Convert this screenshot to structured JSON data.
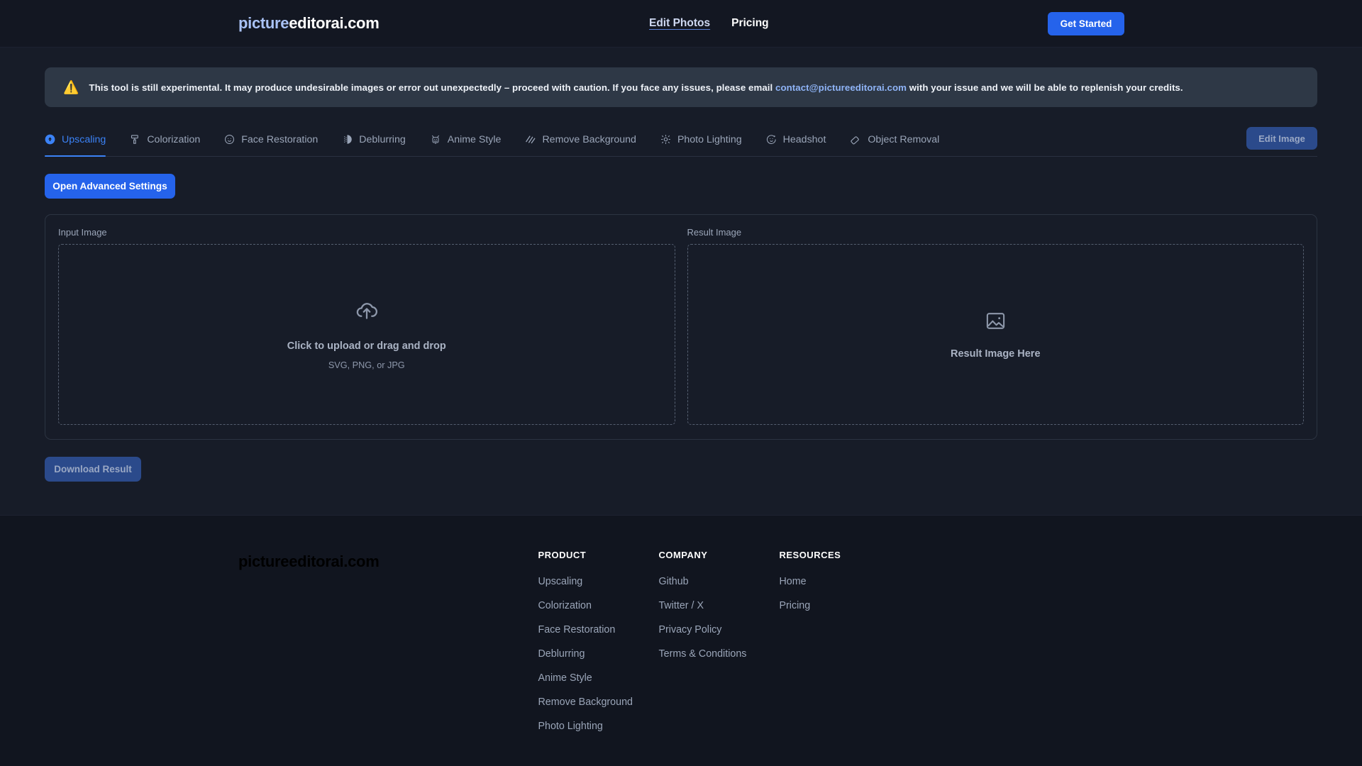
{
  "header": {
    "logo_part1": "picture",
    "logo_part2": "editorai.com",
    "nav": [
      {
        "label": "Edit Photos",
        "active": true
      },
      {
        "label": "Pricing",
        "active": false
      }
    ],
    "cta_label": "Get Started"
  },
  "banner": {
    "icon": "warning-triangle-icon",
    "text_before": "This tool is still experimental. It may produce undesirable images or error out unexpectedly – proceed with caution. If you face any issues, please email ",
    "email": "contact@pictureeditorai.com",
    "text_after": " with your issue and we will be able to replenish your credits."
  },
  "tabs": [
    {
      "label": "Upscaling",
      "icon": "upload-circle-icon",
      "active": true
    },
    {
      "label": "Colorization",
      "icon": "paint-roller-icon",
      "active": false
    },
    {
      "label": "Face Restoration",
      "icon": "smiley-face-icon",
      "active": false
    },
    {
      "label": "Deblurring",
      "icon": "half-blur-circle-icon",
      "active": false
    },
    {
      "label": "Anime Style",
      "icon": "anime-robot-icon",
      "active": false
    },
    {
      "label": "Remove Background",
      "icon": "diagonal-stripes-icon",
      "active": false
    },
    {
      "label": "Photo Lighting",
      "icon": "sun-icon",
      "active": false
    },
    {
      "label": "Headshot",
      "icon": "sparkle-face-icon",
      "active": false
    },
    {
      "label": "Object Removal",
      "icon": "eraser-icon",
      "active": false
    }
  ],
  "toolbar": {
    "edit_image_label": "Edit Image",
    "advanced_settings_label": "Open Advanced Settings",
    "download_label": "Download Result"
  },
  "panel": {
    "input": {
      "label": "Input Image",
      "icon": "cloud-upload-icon",
      "main_text": "Click to upload or drag and drop",
      "sub_text": "SVG, PNG, or JPG"
    },
    "result": {
      "label": "Result Image",
      "icon": "image-placeholder-icon",
      "placeholder_text": "Result Image Here"
    }
  },
  "footer": {
    "logo_part1": "picture",
    "logo_part2": "editorai.com",
    "columns": [
      {
        "title": "PRODUCT",
        "links": [
          "Upscaling",
          "Colorization",
          "Face Restoration",
          "Deblurring",
          "Anime Style",
          "Remove Background",
          "Photo Lighting"
        ]
      },
      {
        "title": "COMPANY",
        "links": [
          "Github",
          "Twitter / X",
          "Privacy Policy",
          "Terms & Conditions"
        ]
      },
      {
        "title": "RESOURCES",
        "links": [
          "Home",
          "Pricing"
        ]
      }
    ]
  },
  "colors": {
    "accent_blue": "#2563eb",
    "muted_blue": "#2b4a8b",
    "page_bg": "#171c28",
    "header_bg": "#131722",
    "banner_bg": "#2e3846",
    "footer_bg": "#11151f",
    "warning_yellow": "#f5c33b",
    "link_blue": "#8fb4f7",
    "logo_blue": "#a9c2f5"
  }
}
